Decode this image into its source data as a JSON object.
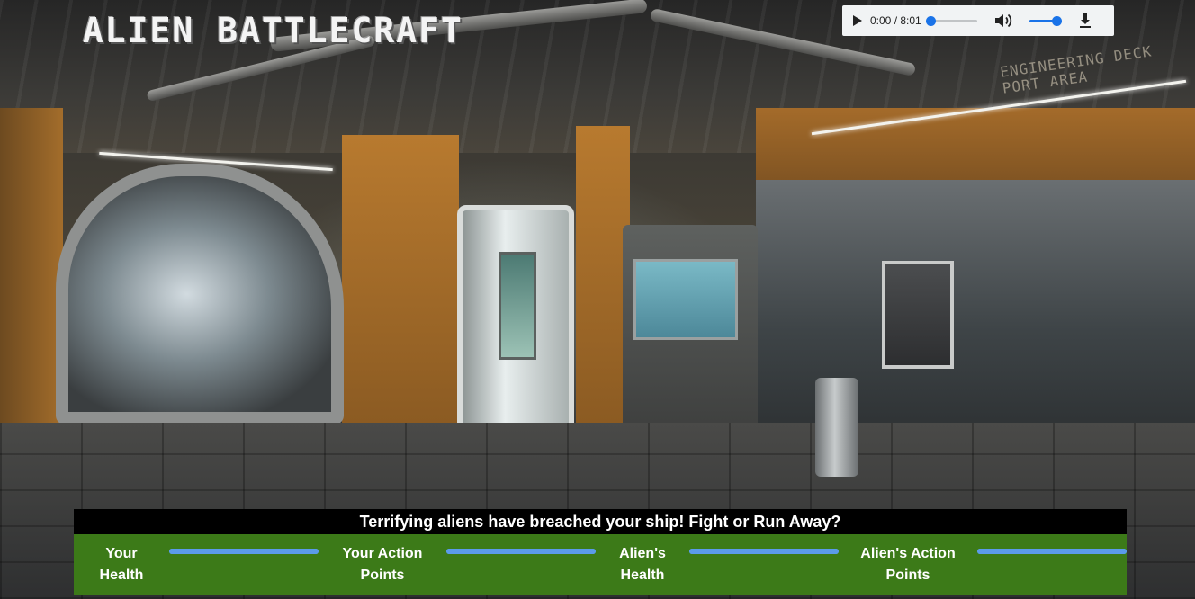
{
  "game": {
    "title": "ALIEN BATTLECRAFT"
  },
  "scene": {
    "sign_line1": "ENGINEERING DECK",
    "sign_line2": "PORT AREA"
  },
  "audio_player": {
    "time_display": "0:00 / 8:01",
    "progress": 0,
    "volume": 1,
    "play_icon": "play-icon",
    "volume_icon": "volume-icon",
    "download_icon": "download-icon",
    "accent_color": "#1a73e8"
  },
  "status_panel": {
    "message": "Terrifying aliens have breached your ship! Fight or Run Away?",
    "stats": [
      {
        "label": "Your\nHealth",
        "value": 1
      },
      {
        "label": "Your Action\nPoints",
        "value": 1
      },
      {
        "label": "Alien's\nHealth",
        "value": 1
      },
      {
        "label": "Alien's Action\nPoints",
        "value": 1
      }
    ],
    "panel_color": "#3c7a18",
    "bar_color": "#5b9bea"
  }
}
